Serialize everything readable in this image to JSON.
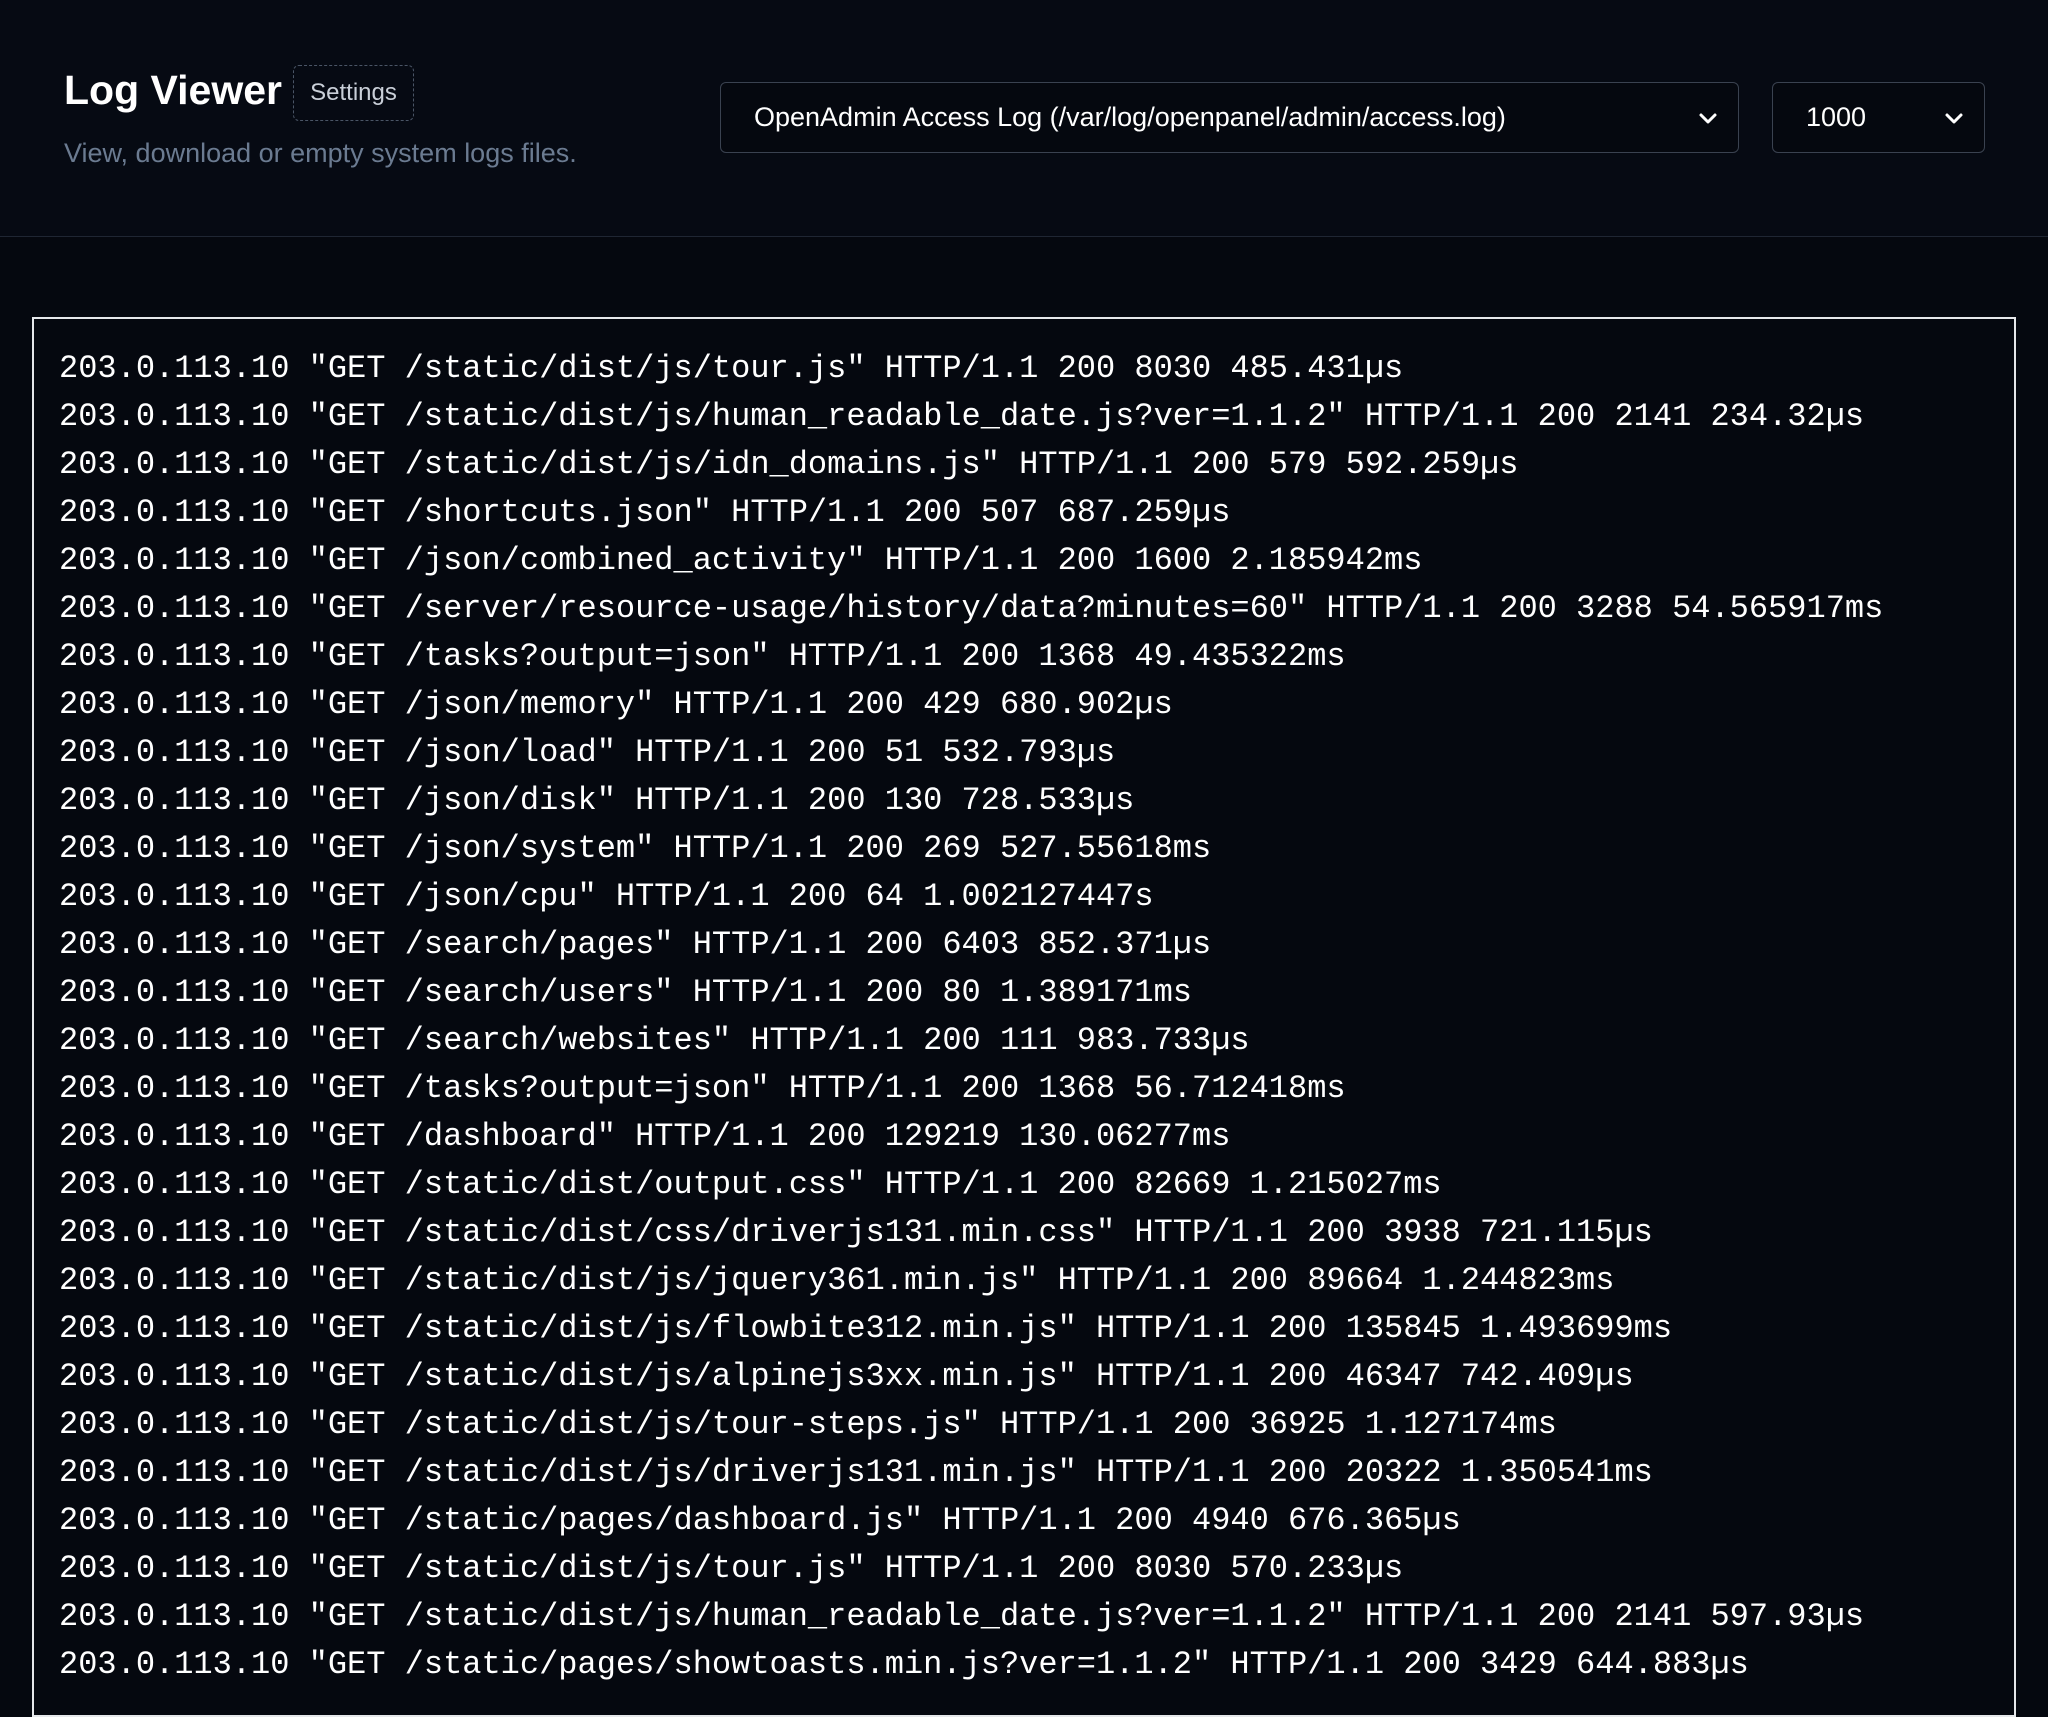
{
  "header": {
    "title": "Log Viewer",
    "settings_label": "Settings",
    "subtitle": "View, download or empty system logs files."
  },
  "controls": {
    "log_file_selected": "OpenAdmin Access Log (/var/log/openpanel/admin/access.log)",
    "lines_selected": "1000"
  },
  "log": {
    "lines": [
      "203.0.113.10 \"GET /static/dist/js/tour.js\" HTTP/1.1 200 8030 485.431µs",
      "203.0.113.10 \"GET /static/dist/js/human_readable_date.js?ver=1.1.2\" HTTP/1.1 200 2141 234.32µs",
      "203.0.113.10 \"GET /static/dist/js/idn_domains.js\" HTTP/1.1 200 579 592.259µs",
      "203.0.113.10 \"GET /shortcuts.json\" HTTP/1.1 200 507 687.259µs",
      "203.0.113.10 \"GET /json/combined_activity\" HTTP/1.1 200 1600 2.185942ms",
      "203.0.113.10 \"GET /server/resource-usage/history/data?minutes=60\" HTTP/1.1 200 3288 54.565917ms",
      "203.0.113.10 \"GET /tasks?output=json\" HTTP/1.1 200 1368 49.435322ms",
      "203.0.113.10 \"GET /json/memory\" HTTP/1.1 200 429 680.902µs",
      "203.0.113.10 \"GET /json/load\" HTTP/1.1 200 51 532.793µs",
      "203.0.113.10 \"GET /json/disk\" HTTP/1.1 200 130 728.533µs",
      "203.0.113.10 \"GET /json/system\" HTTP/1.1 200 269 527.55618ms",
      "203.0.113.10 \"GET /json/cpu\" HTTP/1.1 200 64 1.002127447s",
      "203.0.113.10 \"GET /search/pages\" HTTP/1.1 200 6403 852.371µs",
      "203.0.113.10 \"GET /search/users\" HTTP/1.1 200 80 1.389171ms",
      "203.0.113.10 \"GET /search/websites\" HTTP/1.1 200 111 983.733µs",
      "203.0.113.10 \"GET /tasks?output=json\" HTTP/1.1 200 1368 56.712418ms",
      "203.0.113.10 \"GET /dashboard\" HTTP/1.1 200 129219 130.06277ms",
      "203.0.113.10 \"GET /static/dist/output.css\" HTTP/1.1 200 82669 1.215027ms",
      "203.0.113.10 \"GET /static/dist/css/driverjs131.min.css\" HTTP/1.1 200 3938 721.115µs",
      "203.0.113.10 \"GET /static/dist/js/jquery361.min.js\" HTTP/1.1 200 89664 1.244823ms",
      "203.0.113.10 \"GET /static/dist/js/flowbite312.min.js\" HTTP/1.1 200 135845 1.493699ms",
      "203.0.113.10 \"GET /static/dist/js/alpinejs3xx.min.js\" HTTP/1.1 200 46347 742.409µs",
      "203.0.113.10 \"GET /static/dist/js/tour-steps.js\" HTTP/1.1 200 36925 1.127174ms",
      "203.0.113.10 \"GET /static/dist/js/driverjs131.min.js\" HTTP/1.1 200 20322 1.350541ms",
      "203.0.113.10 \"GET /static/pages/dashboard.js\" HTTP/1.1 200 4940 676.365µs",
      "203.0.113.10 \"GET /static/dist/js/tour.js\" HTTP/1.1 200 8030 570.233µs",
      "203.0.113.10 \"GET /static/dist/js/human_readable_date.js?ver=1.1.2\" HTTP/1.1 200 2141 597.93µs",
      "203.0.113.10 \"GET /static/pages/showtoasts.min.js?ver=1.1.2\" HTTP/1.1 200 3429 644.883µs"
    ]
  },
  "icons": {
    "select_chevron": "chevron-down-icon"
  }
}
